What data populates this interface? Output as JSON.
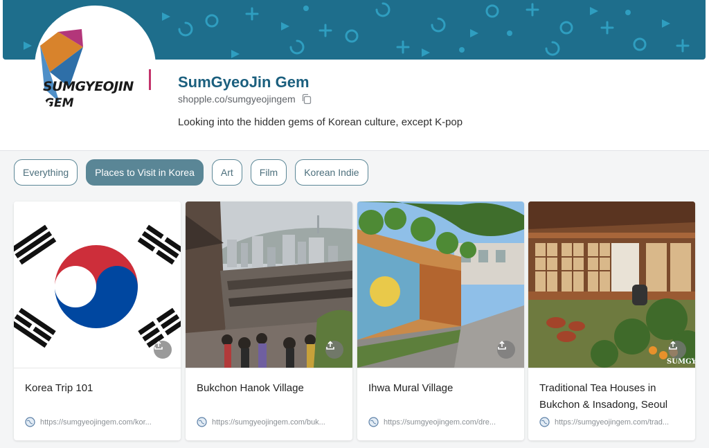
{
  "profile": {
    "name": "SumGyeoJin Gem",
    "url": "shopple.co/sumgyeojingem",
    "bio": "Looking into the hidden gems of Korean culture, except K-pop",
    "logo_text_line1": "SUMGYEOJIN",
    "logo_text_line2": "GEM"
  },
  "tabs": [
    {
      "label": "Everything",
      "active": false
    },
    {
      "label": "Places to Visit in Korea",
      "active": true
    },
    {
      "label": "Art",
      "active": false
    },
    {
      "label": "Film",
      "active": false
    },
    {
      "label": "Korean Indie",
      "active": false
    }
  ],
  "cards": [
    {
      "title": "Korea Trip 101",
      "link": "https://sumgyeojingem.com/kor..."
    },
    {
      "title": "Bukchon Hanok Village",
      "link": "https://sumgyeojingem.com/buk..."
    },
    {
      "title": "Ihwa Mural Village",
      "link": "https://sumgyeojingem.com/dre..."
    },
    {
      "title": "Traditional Tea Houses in Bukchon & Insadong, Seoul",
      "link": "https://sumgyeojingem.com/trad..."
    }
  ],
  "watermark": "SUMGYEO",
  "icons": {
    "copy": "copy-icon",
    "share": "share-icon",
    "link": "globe-icon"
  },
  "colors": {
    "banner": "#1e6e8c",
    "accent": "#5a8696",
    "name": "#1b5f7e"
  }
}
